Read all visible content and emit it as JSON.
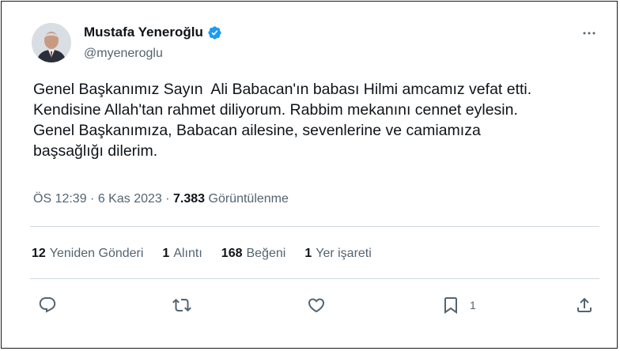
{
  "author": {
    "name": "Mustafa Yeneroğlu",
    "handle": "@myeneroglu"
  },
  "tweet": {
    "text": "Genel Başkanımız Sayın  Ali Babacan'ın babası Hilmi amcamız vefat etti.\nKendisine Allah'tan rahmet diliyorum. Rabbim mekanını cennet eylesin.\nGenel Başkanımıza, Babacan ailesine, sevenlerine ve camiamıza\nbaşsağlığı dilerim.",
    "time": "ÖS 12:39",
    "date": "6 Kas 2023",
    "views_count": "7.383",
    "views_label": "Görüntülenme"
  },
  "stats": {
    "reposts_count": "12",
    "reposts_label": "Yeniden Gönderi",
    "quotes_count": "1",
    "quotes_label": "Alıntı",
    "likes_count": "168",
    "likes_label": "Beğeni",
    "bookmarks_count": "1",
    "bookmarks_label": "Yer işareti"
  },
  "actions": {
    "bookmark_count": "1"
  },
  "icons": [
    "verified-badge-icon",
    "more-options-icon",
    "reply-icon",
    "repost-icon",
    "like-icon",
    "bookmark-icon",
    "share-icon"
  ],
  "colors": {
    "verified": "#1d9bf0",
    "text": "#0f1419",
    "secondary": "#536471",
    "divider": "#cfd9de"
  }
}
